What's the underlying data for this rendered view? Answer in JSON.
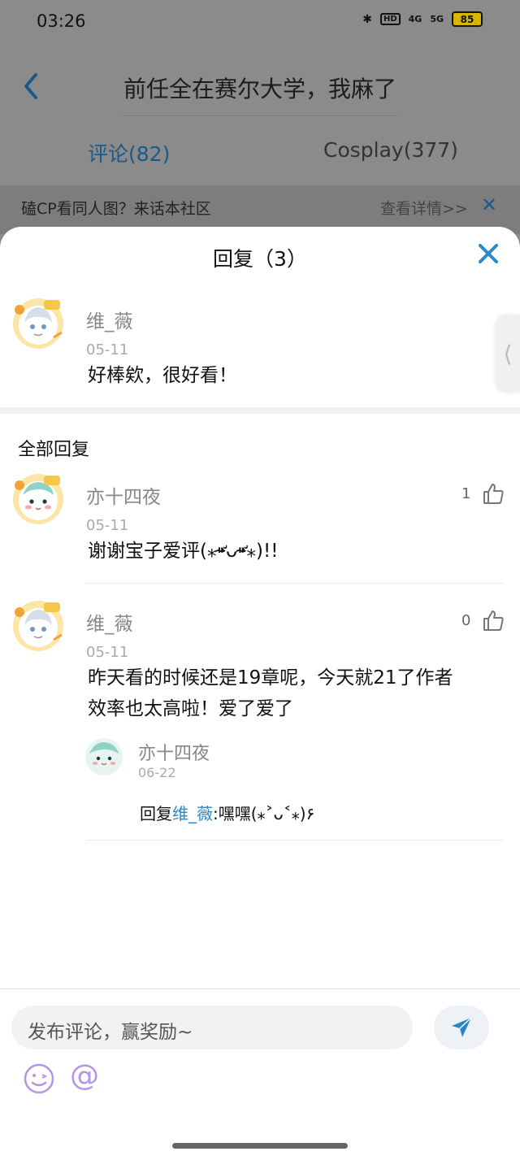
{
  "status_bar": {
    "time": "03:26",
    "network1": "4G",
    "network2": "5G",
    "hd": "HD",
    "battery": "85"
  },
  "background": {
    "title": "前任全在赛尔大学，我麻了",
    "tabs": [
      {
        "label": "评论(82)",
        "active": true
      },
      {
        "label": "Cosplay(377)",
        "active": false
      }
    ],
    "banner": {
      "text": "磕CP看同人图？来话本社区",
      "link": "查看详情>>"
    }
  },
  "sheet": {
    "title": "回复（3）",
    "main_comment": {
      "user": "维_薇",
      "date": "05-11",
      "body": "好棒欸，很好看！"
    },
    "section_title": "全部回复",
    "replies": [
      {
        "user": "亦十四夜",
        "date": "05-11",
        "body": "谢谢宝子爱评(⁎⁍̴̛ᴗ⁍̴̛⁎)!!",
        "likes": "1"
      },
      {
        "user": "维_薇",
        "date": "05-11",
        "body_line1": "昨天看的时候还是19章呢，今天就21了作者",
        "body_line2": "效率也太高啦！爱了爱了",
        "likes": "0",
        "sub_reply": {
          "user": "亦十四夜",
          "date": "06-22",
          "prefix": "回复",
          "mention": "维_薇",
          "text": ":嘿嘿(⁎˃ᴗ˂⁎)۶"
        }
      }
    ]
  },
  "footer": {
    "placeholder": "发布评论，赢奖励~",
    "at_symbol": "@"
  },
  "colors": {
    "accent": "#2a86c8",
    "dim_overlay": "#8b8b8b"
  }
}
